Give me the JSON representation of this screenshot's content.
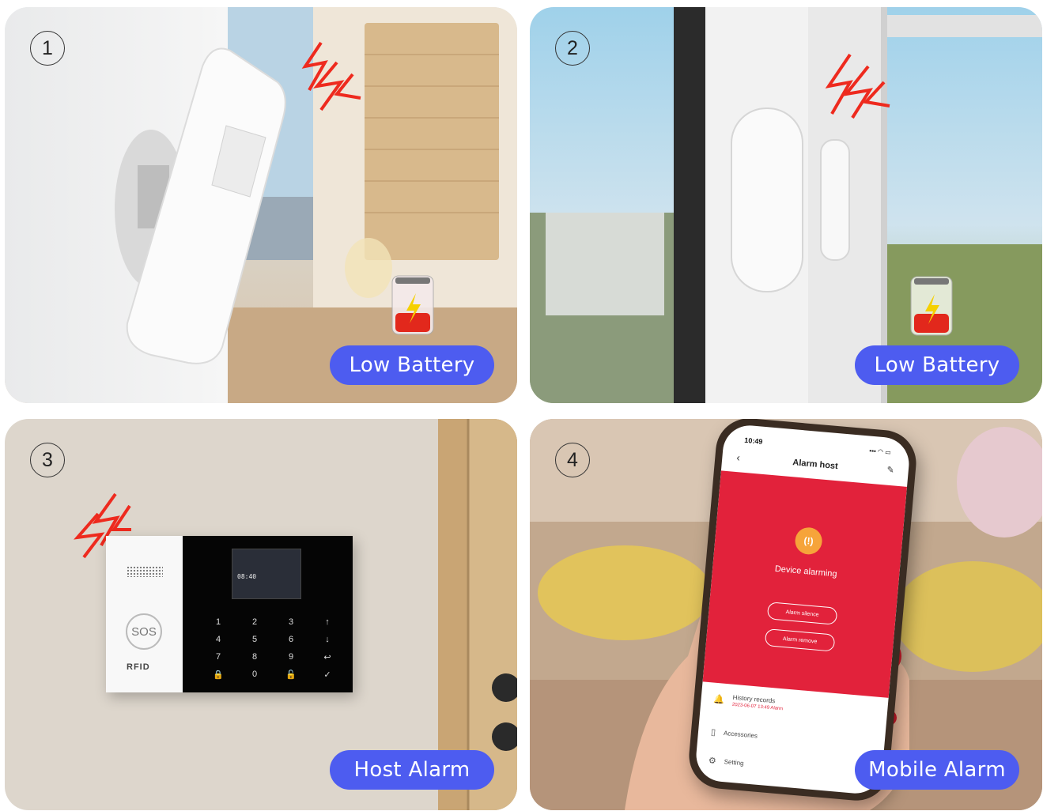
{
  "panels": [
    {
      "number": "1",
      "caption": "Low Battery"
    },
    {
      "number": "2",
      "caption": "Low Battery"
    },
    {
      "number": "3",
      "caption": "Host Alarm"
    },
    {
      "number": "4",
      "caption": "Mobile Alarm"
    }
  ],
  "host": {
    "sos": "SOS",
    "rfid": "RFID",
    "screen_time": "08:40",
    "keys": [
      "1",
      "2",
      "3",
      "↑",
      "4",
      "5",
      "6",
      "↓",
      "7",
      "8",
      "9",
      "↩",
      "🔒",
      "0",
      "🔓",
      "✓"
    ]
  },
  "phone": {
    "status_time": "10:49",
    "status_icons": "▪▪▪ ◠ ▭",
    "title": "Alarm host",
    "status_text": "Device alarming",
    "buttons": [
      "Alarm silence",
      "Alarm remove"
    ],
    "menu": [
      {
        "label": "History records",
        "detail": "2023-06-07 13:49 Alarm"
      },
      {
        "label": "Accessories"
      },
      {
        "label": "Setting"
      }
    ]
  },
  "colors": {
    "accent": "#4d5cf0",
    "alarm_red": "#e2223b",
    "bolt_red": "#ee2a1e"
  }
}
